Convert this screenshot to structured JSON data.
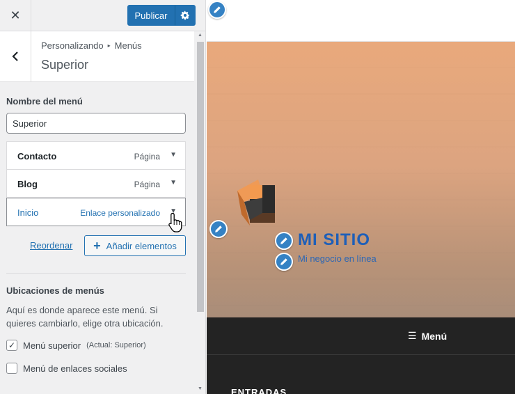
{
  "topbar": {
    "close_glyph": "✕",
    "publish_label": "Publicar",
    "publish_settings_icon": "gear-icon"
  },
  "section": {
    "back_glyph": "‹",
    "breadcrumb_parent": "Personalizando",
    "breadcrumb_separator": "▸",
    "breadcrumb_current": "Menús",
    "title": "Superior"
  },
  "menu_editor": {
    "name_label": "Nombre del menú",
    "name_value": "Superior",
    "items": [
      {
        "title": "Contacto",
        "type": "Página",
        "active": false
      },
      {
        "title": "Blog",
        "type": "Página",
        "active": false
      },
      {
        "title": "Inicio",
        "type": "Enlace personalizado",
        "active": true
      }
    ],
    "item_arrow": "▼",
    "reorder_label": "Reordenar",
    "add_plus": "+",
    "add_label": "Añadir elementos"
  },
  "locations": {
    "heading": "Ubicaciones de menús",
    "description": "Aquí es donde aparece este menú. Si quieres cambiarlo, elige otra ubicación.",
    "options": [
      {
        "label": "Menú superior",
        "note": "(Actual: Superior)",
        "checked": true
      },
      {
        "label": "Menú de enlaces sociales",
        "note": "",
        "checked": false
      }
    ],
    "check_glyph": "✓"
  },
  "preview": {
    "site_title": "MI SITIO",
    "site_tagline": "Mi negocio en línea",
    "menu_toggle_glyph": "☰",
    "menu_toggle_label": "Menú",
    "entries_heading": "ENTRADAS"
  },
  "colors": {
    "accent": "#2271b1",
    "shortcut": "#3582c4",
    "site_title": "#1e5fb8",
    "navbar": "#232323"
  }
}
